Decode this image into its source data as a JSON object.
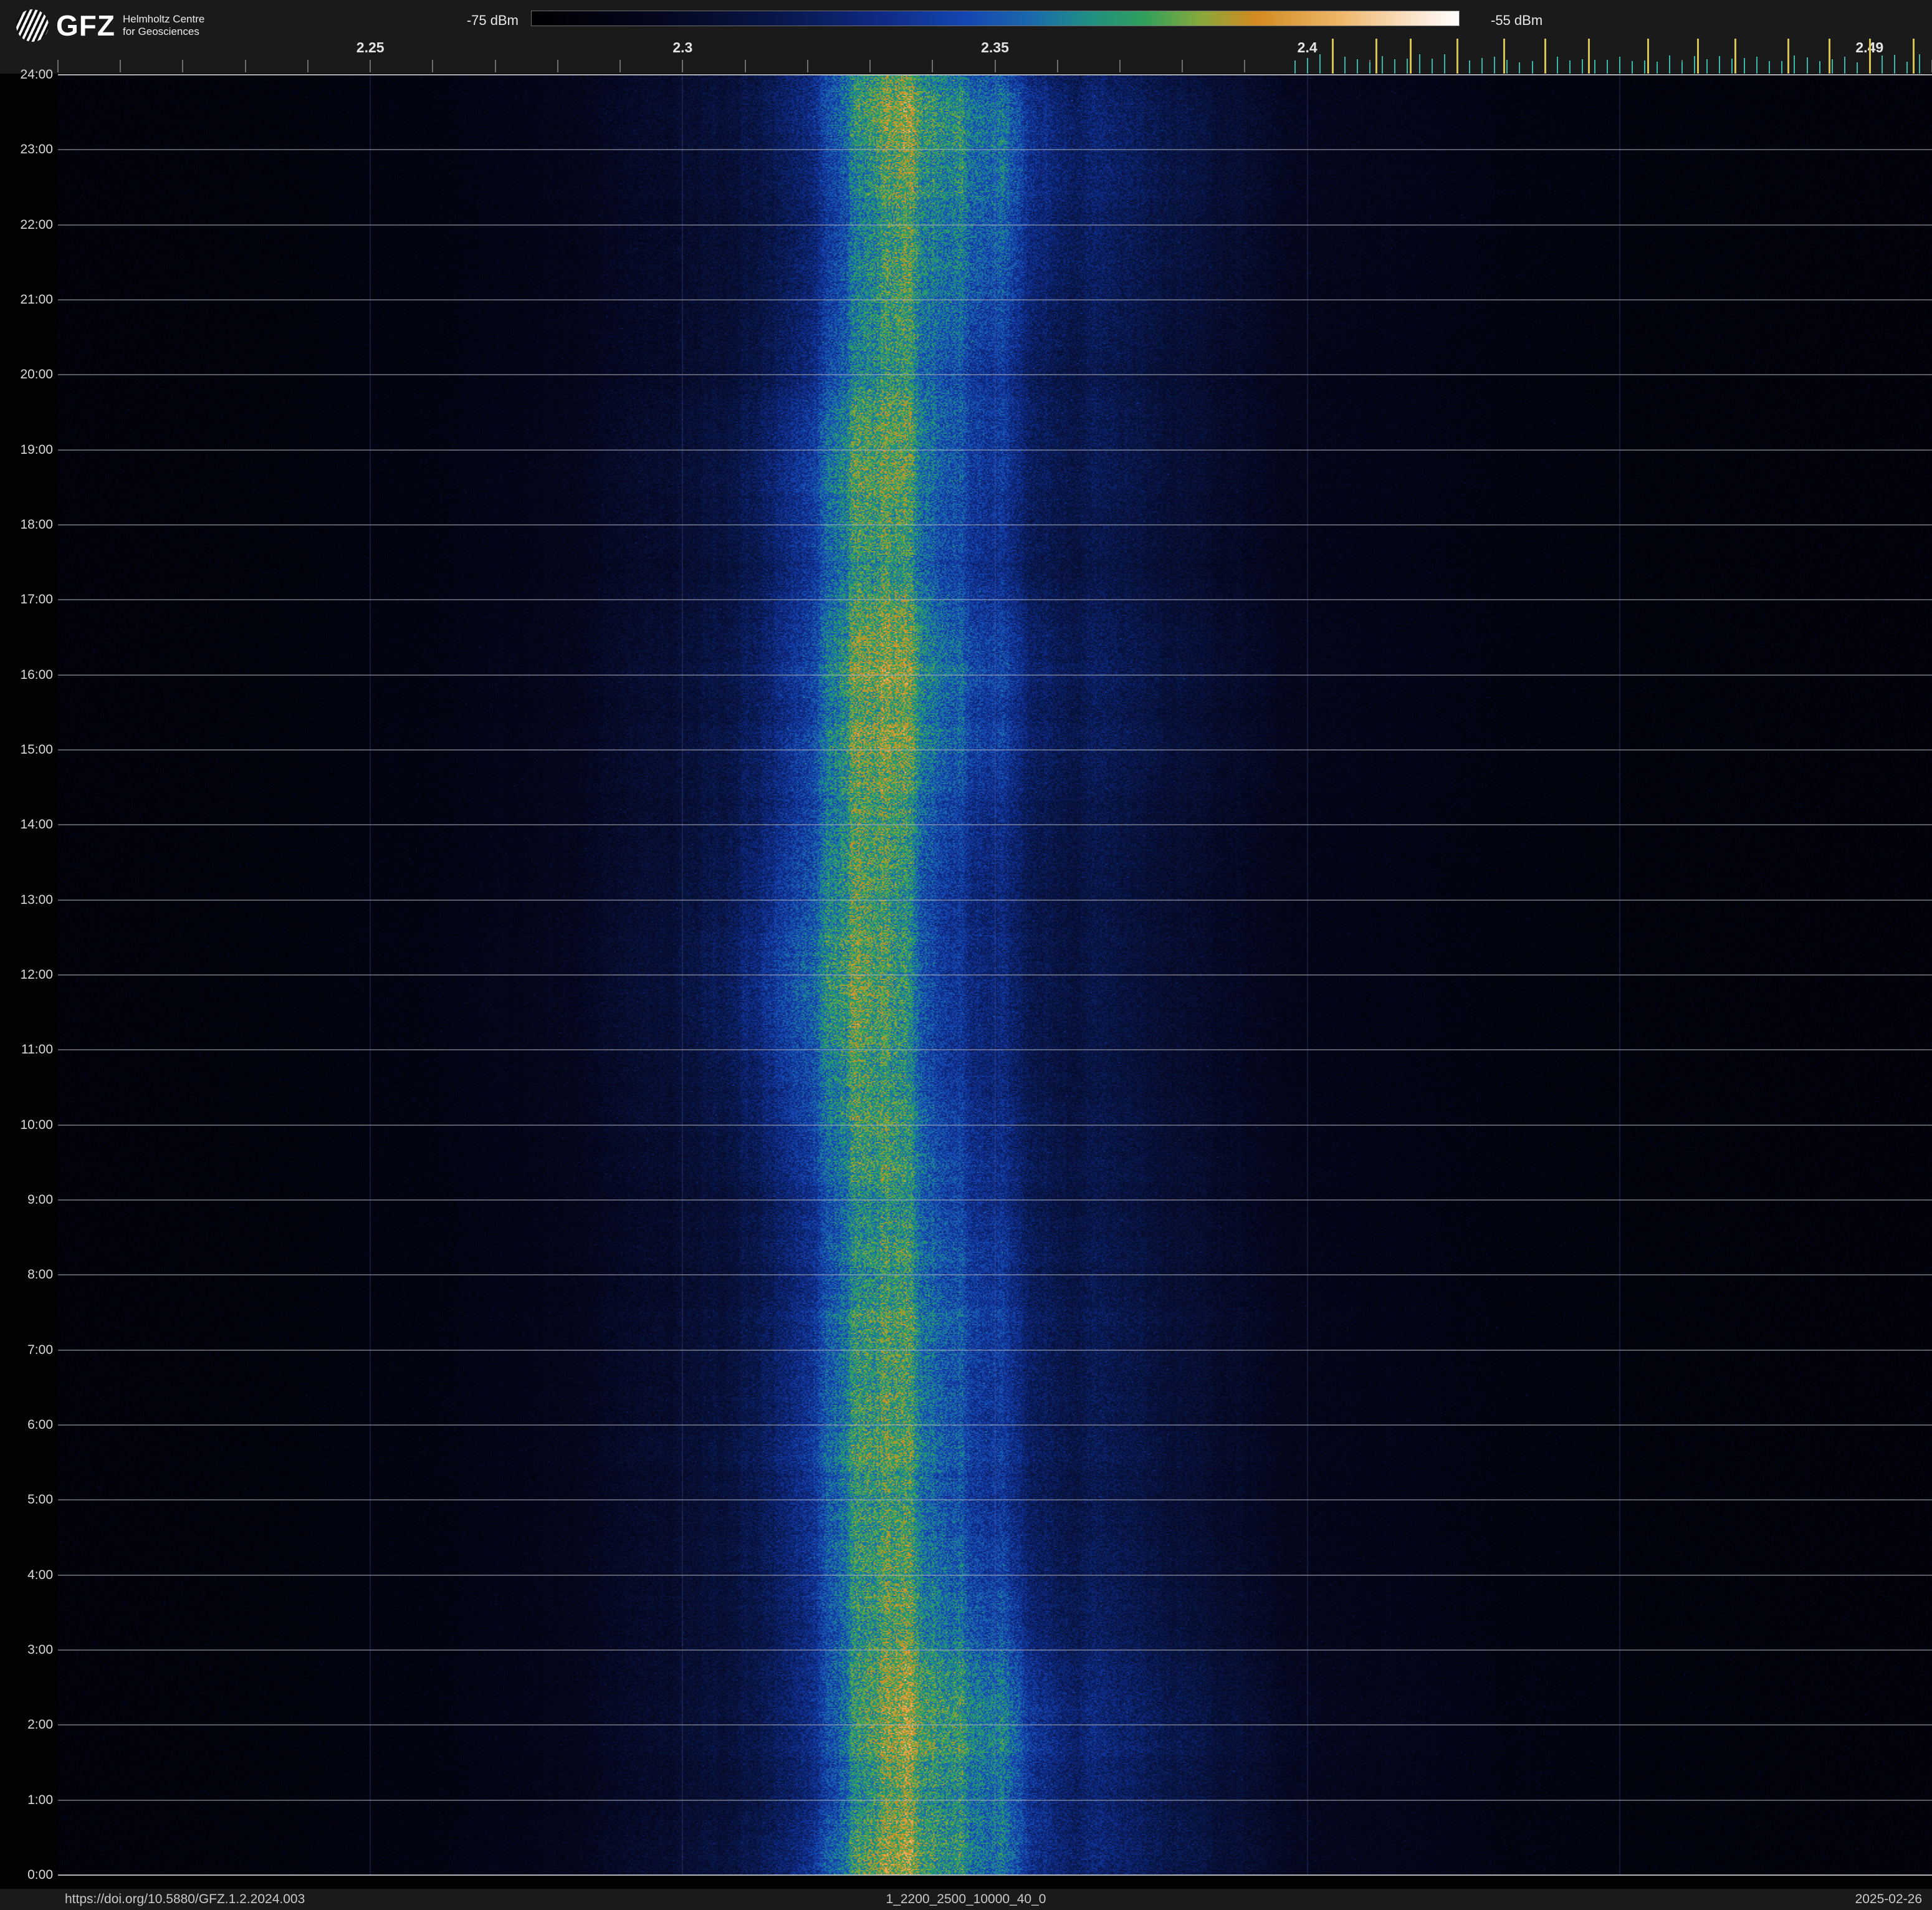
{
  "header": {
    "logo_text": "GFZ",
    "org_line1": "Helmholtz Centre",
    "org_line2": "for Geosciences"
  },
  "footer": {
    "doi": "https://doi.org/10.5880/GFZ.1.2.2024.003",
    "dataset_id": "1_2200_2500_10000_40_0",
    "date": "2025-02-26"
  },
  "chart_data": {
    "type": "heatmap",
    "description": "24-hour radio-frequency spectrogram (waterfall): frequency on x-axis, time of day on y-axis, received power encoded by color; a persistent emission band is centered near 2.33 GHz",
    "x_axis": {
      "unit": "GHz",
      "min": 2.2,
      "max": 2.5,
      "major_ticks": [
        {
          "label": "2.25",
          "ghz": 2.25
        },
        {
          "label": "2.3",
          "ghz": 2.3
        },
        {
          "label": "2.35",
          "ghz": 2.35
        },
        {
          "label": "2.4",
          "ghz": 2.4
        },
        {
          "label": "2.49",
          "ghz": 2.49
        }
      ],
      "minor_tick_step_ghz": 0.01
    },
    "y_axis": {
      "unit": "time of day",
      "hour_labels": [
        "0:00",
        "1:00",
        "2:00",
        "3:00",
        "4:00",
        "5:00",
        "6:00",
        "7:00",
        "8:00",
        "9:00",
        "10:00",
        "11:00",
        "12:00",
        "13:00",
        "14:00",
        "15:00",
        "16:00",
        "17:00",
        "18:00",
        "19:00",
        "20:00",
        "21:00",
        "22:00",
        "23:00",
        "24:00"
      ]
    },
    "color_scale": {
      "min_dbm": -75,
      "max_dbm": -55,
      "min_label": "-75 dBm",
      "max_label": "-55 dBm",
      "stops": [
        {
          "v": 0.0,
          "color": "#000002"
        },
        {
          "v": 0.14,
          "color": "#04071f"
        },
        {
          "v": 0.26,
          "color": "#081546"
        },
        {
          "v": 0.38,
          "color": "#0e2b86"
        },
        {
          "v": 0.47,
          "color": "#1547b2"
        },
        {
          "v": 0.54,
          "color": "#1b6aab"
        },
        {
          "v": 0.6,
          "color": "#1f8f84"
        },
        {
          "v": 0.66,
          "color": "#2fa05c"
        },
        {
          "v": 0.72,
          "color": "#86a93c"
        },
        {
          "v": 0.78,
          "color": "#d28a20"
        },
        {
          "v": 0.87,
          "color": "#eeb568"
        },
        {
          "v": 0.94,
          "color": "#f9ddbd"
        },
        {
          "v": 1.0,
          "color": "#ffffff"
        }
      ]
    },
    "signal_band": {
      "center_ghz": 2.333,
      "drift_ghz": 0.0035,
      "core_sigma_ghz": 0.011,
      "glow_sigma_ghz": 0.03,
      "wide_sigma_ghz": 0.058,
      "core_amp": 0.44,
      "glow_amp": 0.24,
      "wide_amp": 0.09,
      "approx_peak_dbm": -62
    },
    "detector_ticks": {
      "teal_color": "#39b8aa",
      "yellow_color": "#d7c24b",
      "teal_start_ghz": 2.398,
      "teal_end_ghz": 2.498,
      "teal_step_ghz": 0.002,
      "yellow_positions_ghz": [
        2.404,
        2.411,
        2.4165,
        2.424,
        2.4315,
        2.438,
        2.445,
        2.4545,
        2.4625,
        2.4685,
        2.477,
        2.4835,
        2.49,
        2.497
      ]
    },
    "grid": {
      "h_line_color": "rgba(178,182,190,0.5)",
      "edge_line_color": "rgba(208,211,217,0.85)",
      "v_line_color": "rgba(130,150,235,0.14)",
      "v_lines_ghz": [
        2.25,
        2.3,
        2.35,
        2.4,
        2.45
      ]
    }
  }
}
